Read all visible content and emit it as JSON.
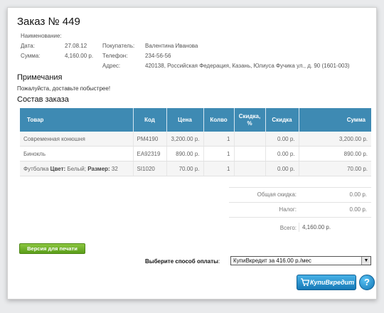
{
  "order": {
    "title": "Заказ № 449",
    "fields": {
      "name_label": "Наименование:",
      "date_label": "Дата:",
      "date_value": "27.08.12",
      "sum_label": "Сумма:",
      "sum_value": "4,160.00 р.",
      "buyer_label": "Покупатель:",
      "buyer_value": "Валентина Иванова",
      "phone_label": "Телефон:",
      "phone_value": "234-56-56",
      "address_label": "Адрес:",
      "address_value": "420138, Российская Федерация, Казань, Юлиуса Фучика ул., д. 90 (1601-003)"
    },
    "notes_heading": "Примечания",
    "notes_text": "Пожалуйста, доставьте побыстрее!",
    "composition_heading": "Состав заказа"
  },
  "table": {
    "headers": {
      "product": "Товар",
      "code": "Код",
      "price": "Цена",
      "qty": "Колво",
      "discount_pct_1": "Скидка,",
      "discount_pct_2": "%",
      "discount": "Скидка",
      "sum": "Сумма"
    },
    "rows": [
      {
        "product": "Современная конюшня",
        "code": "PM4190",
        "price": "3,200.00 р.",
        "qty": "1",
        "discount_pct": "",
        "discount": "0.00 р.",
        "sum": "3,200.00 р."
      },
      {
        "product": "Бинокль",
        "code": "EA92319",
        "price": "890.00 р.",
        "qty": "1",
        "discount_pct": "",
        "discount": "0.00 р.",
        "sum": "890.00 р."
      },
      {
        "product_prefix": "Футболка ",
        "color_label": "Цвет:",
        "color_value": " Белый; ",
        "size_label": "Размер:",
        "size_value": " 32",
        "code": "SI1020",
        "price": "70.00 р.",
        "qty": "1",
        "discount_pct": "",
        "discount": "0.00 р.",
        "sum": "70.00 р."
      }
    ]
  },
  "summary": {
    "total_discount_label": "Общая скидка:",
    "total_discount_value": "0.00 р.",
    "tax_label": "Налог:",
    "tax_value": "0.00 р.",
    "total_label": "Всего:",
    "total_value": "4,160.00 р."
  },
  "actions": {
    "print_label": "Версия для печати",
    "payment_label": "Выберите способ оплаты",
    "payment_colon": ":",
    "payment_selected": "КупиВкредит за 416.00 р./мес",
    "kupi_label": "КупиВкредит",
    "help_label": "?"
  },
  "colors": {
    "table_header": "#3e8ab3",
    "print_button": "#6bb22b",
    "kupi_button": "#2a92cf"
  },
  "icons": {
    "cart": "cart-icon",
    "help": "question-icon",
    "dropdown": "chevron-down-icon"
  }
}
